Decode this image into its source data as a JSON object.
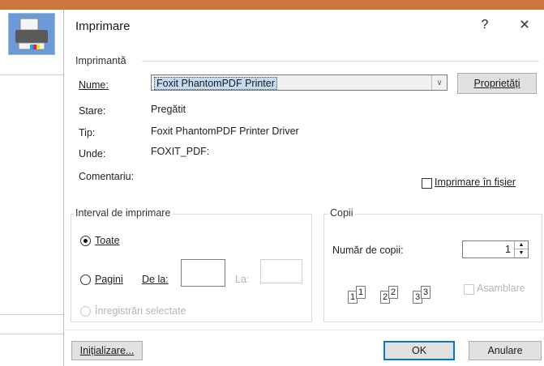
{
  "dialog": {
    "title": "Imprimare",
    "help": "?",
    "close": "×"
  },
  "printer": {
    "group_label": "Imprimantă",
    "name_label": "Nume:",
    "name_value": "Foxit PhantomPDF Printer",
    "properties_button": "Proprietăți",
    "status_label": "Stare:",
    "status_value": "Pregătit",
    "type_label": "Tip:",
    "type_value": "Foxit PhantomPDF Printer Driver",
    "where_label": "Unde:",
    "where_value": "FOXIT_PDF:",
    "comment_label": "Comentariu:",
    "print_to_file_label": "Imprimare în fișier",
    "print_to_file_checked": false
  },
  "range": {
    "group_label": "Interval de imprimare",
    "all_label": "Toate",
    "all_selected": true,
    "pages_label": "Pagini",
    "from_label": "De la:",
    "from_value": "",
    "to_label": "La:",
    "to_value": "",
    "selection_label": "Înregistrări selectate"
  },
  "copies": {
    "group_label": "Copii",
    "count_label": "Număr de copii:",
    "count_value": "1",
    "collate_label": "Asamblare",
    "collate_checked": false,
    "collate_pages": [
      "1",
      "1",
      "2",
      "2",
      "3",
      "3"
    ]
  },
  "footer": {
    "setup_button": "Inițializare...",
    "ok_button": "OK",
    "cancel_button": "Anulare"
  },
  "colors": {
    "accent": "#0078d7",
    "selection": "#c5dbf1",
    "topbar": "#c9773a"
  },
  "icons": {
    "printer": "printer-icon",
    "dropdown": "chevron-down-icon",
    "spin_up": "arrow-up-icon",
    "spin_down": "arrow-down-icon"
  }
}
